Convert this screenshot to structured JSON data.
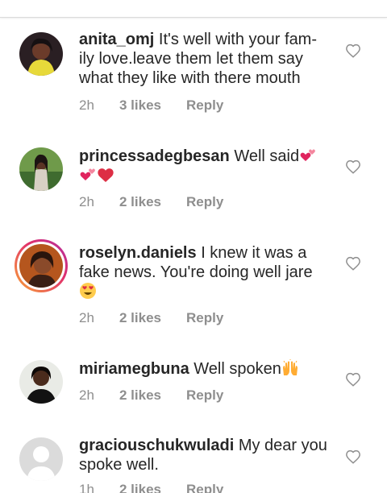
{
  "comments": [
    {
      "username": "anita_omj",
      "text": "It's well with your fam-ily love.leave them let them say what they like with there mouth",
      "time": "2h",
      "likes": "3 likes",
      "reply": "Reply"
    },
    {
      "username": "princessadegbesan",
      "text": "Well said",
      "time": "2h",
      "likes": "2 likes",
      "reply": "Reply"
    },
    {
      "username": "roselyn.daniels",
      "text": "I knew it was a fake news. You're doing well jare",
      "time": "2h",
      "likes": "2 likes",
      "reply": "Reply"
    },
    {
      "username": "miriamegbuna",
      "text": "Well spoken",
      "time": "2h",
      "likes": "2 likes",
      "reply": "Reply"
    },
    {
      "username": "graciouschukwuladi",
      "text": "My dear you spoke well.",
      "time": "1h",
      "likes": "2 likes",
      "reply": "Reply"
    }
  ],
  "icons": {
    "like": "heart-outline-icon",
    "emoji_hearts": "revolving-hearts-emoji",
    "emoji_red_heart": "red-heart-emoji",
    "emoji_heart_eyes": "heart-eyes-emoji",
    "emoji_raised_hands": "raised-hands-emoji"
  },
  "colors": {
    "username": "#262626",
    "meta": "#8e8e8e",
    "story_ring_start": "#f9a534",
    "story_ring_end": "#b02fa1"
  }
}
